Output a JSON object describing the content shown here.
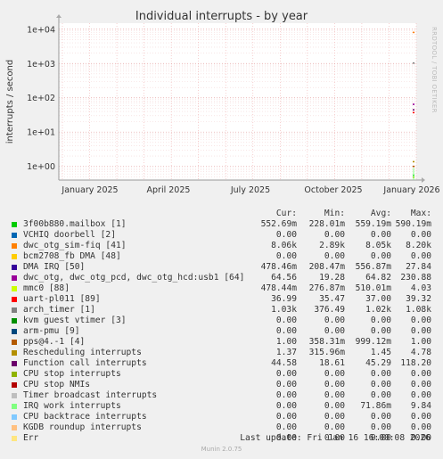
{
  "chart_data": {
    "type": "line",
    "title": "Individual interrupts - by year",
    "ylabel": "interrupts / second",
    "xlabel": "",
    "yscale": "log",
    "ylim": [
      0.4,
      15000
    ],
    "yticks": [
      "1e+00",
      "1e+01",
      "1e+02",
      "1e+03",
      "1e+04"
    ],
    "x_ticks": [
      "January 2025",
      "April 2025",
      "July 2025",
      "October 2025",
      "January 2026"
    ],
    "grid": true,
    "legend": "below",
    "series": [
      {
        "name": "3f00b880.mailbox [1]",
        "color": "#00cc00",
        "cur": "552.69m",
        "min": "228.01m",
        "avg": "559.19m",
        "max": "590.19m"
      },
      {
        "name": "VCHIQ doorbell [2]",
        "color": "#0066b3",
        "cur": "0.00",
        "min": "0.00",
        "avg": "0.00",
        "max": "0.00"
      },
      {
        "name": "dwc_otg_sim-fiq [41]",
        "color": "#ff8000",
        "cur": "8.06k",
        "min": "2.89k",
        "avg": "8.05k",
        "max": "8.20k"
      },
      {
        "name": "bcm2708_fb DMA [48]",
        "color": "#ffcc00",
        "cur": "0.00",
        "min": "0.00",
        "avg": "0.00",
        "max": "0.00"
      },
      {
        "name": "DMA IRQ [50]",
        "color": "#330099",
        "cur": "478.46m",
        "min": "208.47m",
        "avg": "556.87m",
        "max": "27.84"
      },
      {
        "name": "dwc_otg, dwc_otg_pcd, dwc_otg_hcd:usb1 [64]",
        "color": "#990099",
        "cur": "64.56",
        "min": "19.28",
        "avg": "64.82",
        "max": "230.88"
      },
      {
        "name": "mmc0 [88]",
        "color": "#ccff00",
        "cur": "478.44m",
        "min": "276.87m",
        "avg": "510.01m",
        "max": "4.03"
      },
      {
        "name": "uart-pl011 [89]",
        "color": "#ff0000",
        "cur": "36.99",
        "min": "35.47",
        "avg": "37.00",
        "max": "39.32"
      },
      {
        "name": "arch_timer [1]",
        "color": "#808080",
        "cur": "1.03k",
        "min": "376.49",
        "avg": "1.02k",
        "max": "1.08k"
      },
      {
        "name": "kvm guest vtimer [3]",
        "color": "#008f00",
        "cur": "0.00",
        "min": "0.00",
        "avg": "0.00",
        "max": "0.00"
      },
      {
        "name": "arm-pmu [9]",
        "color": "#00487d",
        "cur": "0.00",
        "min": "0.00",
        "avg": "0.00",
        "max": "0.00"
      },
      {
        "name": "pps@4.-1 [4]",
        "color": "#b35a00",
        "cur": "1.00",
        "min": "358.31m",
        "avg": "999.12m",
        "max": "1.00"
      },
      {
        "name": "Rescheduling interrupts",
        "color": "#b38f00",
        "cur": "1.37",
        "min": "315.96m",
        "avg": "1.45",
        "max": "4.78"
      },
      {
        "name": "Function call interrupts",
        "color": "#6b006b",
        "cur": "44.58",
        "min": "18.61",
        "avg": "45.29",
        "max": "118.20"
      },
      {
        "name": "CPU stop interrupts",
        "color": "#8fb300",
        "cur": "0.00",
        "min": "0.00",
        "avg": "0.00",
        "max": "0.00"
      },
      {
        "name": "CPU stop NMIs",
        "color": "#b30000",
        "cur": "0.00",
        "min": "0.00",
        "avg": "0.00",
        "max": "0.00"
      },
      {
        "name": "Timer broadcast interrupts",
        "color": "#bebebe",
        "cur": "0.00",
        "min": "0.00",
        "avg": "0.00",
        "max": "0.00"
      },
      {
        "name": "IRQ work interrupts",
        "color": "#80ff80",
        "cur": "0.00",
        "min": "0.00",
        "avg": "71.86m",
        "max": "9.84"
      },
      {
        "name": "CPU backtrace interrupts",
        "color": "#80c9ff",
        "cur": "0.00",
        "min": "0.00",
        "avg": "0.00",
        "max": "0.00"
      },
      {
        "name": "KGDB roundup interrupts",
        "color": "#ffc080",
        "cur": "0.00",
        "min": "0.00",
        "avg": "0.00",
        "max": "0.00"
      },
      {
        "name": "Err",
        "color": "#ffe680",
        "cur": "0.00",
        "min": "0.00",
        "avg": "0.00",
        "max": "0.00"
      }
    ],
    "plotted_values": [
      0.55,
      0,
      8060,
      0,
      0.48,
      64.56,
      0.48,
      36.99,
      1030,
      0,
      0,
      1.0,
      1.37,
      44.58,
      0,
      0,
      0,
      0,
      0,
      0,
      0
    ]
  },
  "legend_headers": {
    "cur": "Cur:",
    "min": "Min:",
    "avg": "Avg:",
    "max": "Max:"
  },
  "side_label": "RRDTOOL / TOBI OETIKER",
  "footer": "Last update: Fri Jan 16 16:00:08 2026",
  "munin_version": "Munin 2.0.75"
}
